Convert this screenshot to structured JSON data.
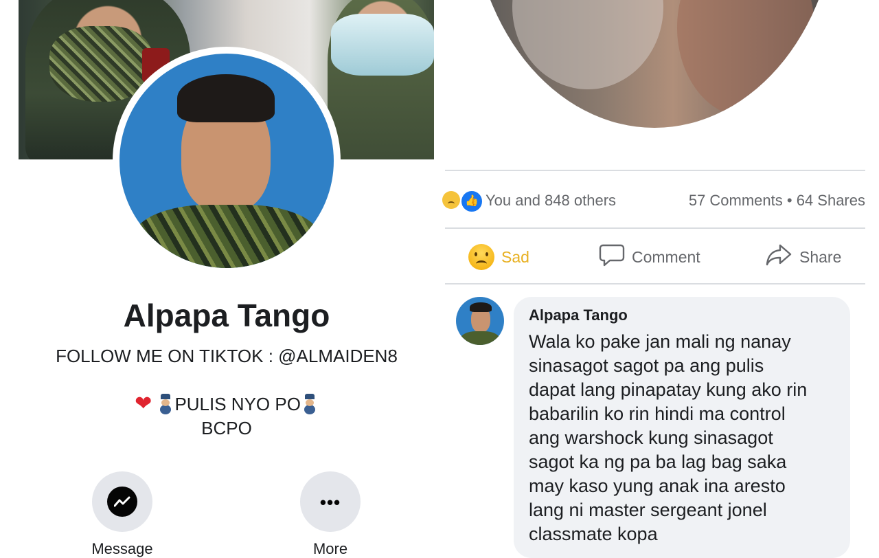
{
  "profile": {
    "name": "Alpapa Tango",
    "bio_line1": "FOLLOW ME ON TIKTOK : @ALMAIDEN8",
    "bio_line2": "PULIS NYO PO",
    "bio_line3": "BCPO",
    "actions": [
      {
        "label": "Message",
        "icon": "messenger-icon"
      },
      {
        "label": "More",
        "icon": "more-dots-icon"
      }
    ]
  },
  "post": {
    "reactions_text": "You and 848 others",
    "comments_shares": "57 Comments • 64 Shares",
    "buttons": {
      "sad": "Sad",
      "comment": "Comment",
      "share": "Share"
    },
    "comment": {
      "author": "Alpapa Tango",
      "lines": [
        "Wala ko pake jan mali ng nanay",
        "sinasagot sagot pa ang pulis",
        "dapat lang pinapatay kung ako rin",
        "babarilin ko rin hindi ma control",
        "ang warshock kung sinasagot",
        "sagot ka ng pa ba lag bag saka",
        "may kaso yung anak ina aresto",
        "lang ni master sergeant jonel",
        "classmate kopa"
      ]
    }
  },
  "colors": {
    "accent_blue": "#1877f2",
    "sad_yellow": "#e8b021",
    "bubble_bg": "#f0f2f5"
  }
}
